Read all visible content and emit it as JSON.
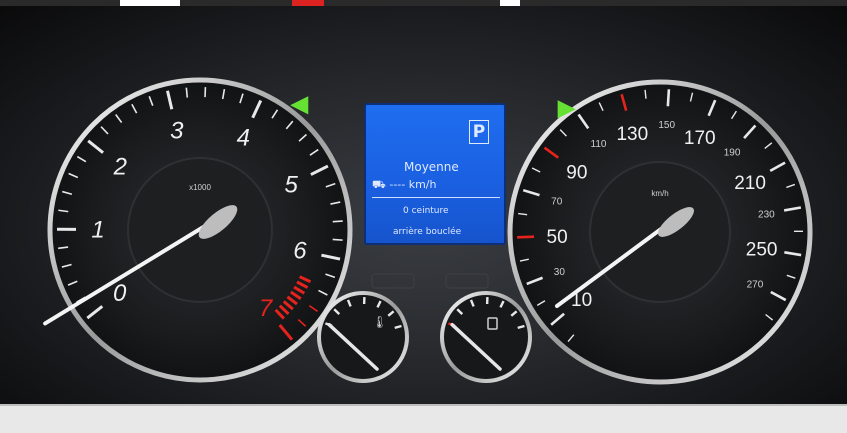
{
  "tachometer": {
    "numbers": [
      "0",
      "1",
      "2",
      "3",
      "4",
      "5",
      "6",
      "7"
    ],
    "unit": "x1000",
    "redline_from": 6.5,
    "needle_value": 0
  },
  "speedometer": {
    "major_numbers": [
      "10",
      "50",
      "90",
      "130",
      "170",
      "210",
      "250"
    ],
    "minor_numbers": [
      "30",
      "70",
      "110",
      "150",
      "190",
      "230",
      "270"
    ],
    "unit": "km/h",
    "needle_value": 0
  },
  "temperature_gauge": {
    "icon": "coolant-temperature-icon",
    "level": 0.0
  },
  "fuel_gauge": {
    "icon": "fuel-pump-icon",
    "level": 0.0
  },
  "display": {
    "gear": "P",
    "average_label": "Moyenne",
    "range_line": "---- km/h",
    "belt_line1": "0 ceinture",
    "belt_line2": "arrière bouclée"
  },
  "indicators": {
    "left_turn": "left-turn-arrow-icon",
    "right_turn": "right-turn-arrow-icon",
    "color": "#66e033"
  },
  "colors": {
    "redline": "#e8221c",
    "display": "#1a5fe0",
    "chrome": "#e6e6e6"
  }
}
